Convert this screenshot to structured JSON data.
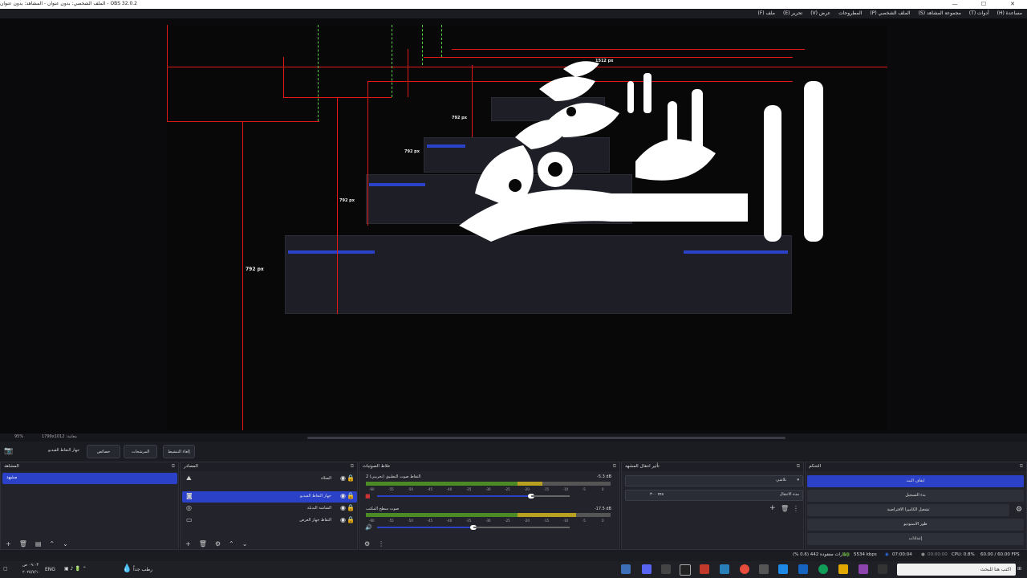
{
  "window": {
    "title": "الملف الشخصي: بدون عنوان - المشاهد: بدون عنوان - OBS 32.0.2",
    "min": "—",
    "max": "☐",
    "close": "✕"
  },
  "menu": [
    "ملف (F)",
    "تحرير (E)",
    "عرض (V)",
    "المطروحات",
    "الملف الشخصي (P)",
    "مجموعة المشاهد (S)",
    "أدوات (T)",
    "مساعدة (H)"
  ],
  "preview": {
    "dims": {
      "a": "1512 px",
      "b": "792 px",
      "c": "792 px",
      "d": "792 px",
      "e": "792 px"
    },
    "zoom_text": "95%",
    "resolution_text": "1799x1012 :معاينة"
  },
  "source_toolbar": {
    "device_name": "جهاز التقاط الفيديو",
    "properties": "خصائص",
    "filters": "المرشحات",
    "deactivate": "إلغاء التنشيط"
  },
  "scenes_dock": {
    "title": "المشاهد",
    "item": "مشهد"
  },
  "sources_dock": {
    "title": "المصادر",
    "items": [
      {
        "label": "الصلاة",
        "icon": "image-icon"
      },
      {
        "label": "جهاز التقاط الفيديو",
        "icon": "camera-icon"
      },
      {
        "label": "الشاشة البديلة",
        "icon": "eye-icon"
      },
      {
        "label": "التقاط جهاز العرض",
        "icon": "monitor-icon"
      }
    ]
  },
  "mixer_dock": {
    "title": "خلاط الصوتيات",
    "channels": [
      {
        "name": "التقاط صوت التطبيق (تجريبي) 2",
        "db": "-5.3 dB",
        "level": 0.72,
        "fader": 0.8
      },
      {
        "name": "صوت سطح المكتب",
        "db": "-17.5 dB",
        "level": 0.86,
        "fader": 0.5
      }
    ],
    "ticks": [
      "-60",
      "-55",
      "-50",
      "-45",
      "-40",
      "-35",
      "-30",
      "-25",
      "-20",
      "-15",
      "-10",
      "-5",
      "0"
    ]
  },
  "transitions_dock": {
    "title": "تأثير انتقال المشهد",
    "selected": "تلاشي",
    "duration_label": "مدة الانتقال",
    "duration_value": "٣٠٠ ms"
  },
  "controls_dock": {
    "title": "التحكم",
    "buttons": [
      "ايقاف البث",
      "بدء التسجيل",
      "تشغيل الكاميرا الافتراضية",
      "طور الاستوديو",
      "إعدادات"
    ]
  },
  "status": {
    "frames": "إطارات مفقودة 442 (0.6 %)",
    "bitrate": "5534 kbps",
    "stream_time": "07:00:04",
    "rec_time": "00:00:00",
    "cpu": "CPU: 0.8%",
    "fps": "60.00 / 60.00 FPS"
  },
  "taskbar": {
    "time": "٠٩:٠٣ ص",
    "date": "٢٠٢٥/٧/١٠",
    "lang": "ENG",
    "weather": "رطب جداً",
    "search_placeholder": "اكتب هنا للبحث"
  },
  "colors": {
    "accent": "#2b42c8",
    "guide_red": "#e01818",
    "guide_green": "#5cd04a"
  }
}
